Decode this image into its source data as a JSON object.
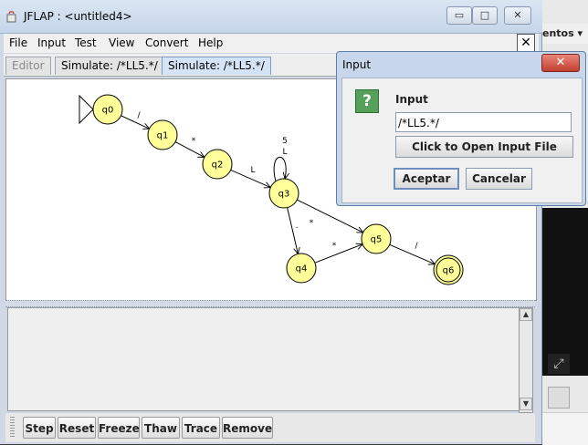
{
  "window": {
    "title": "JFLAP : <untitled4>",
    "min_glyph": "▭",
    "max_glyph": "□",
    "close_glyph": "✕"
  },
  "menu": [
    "File",
    "Input",
    "Test",
    "View",
    "Convert",
    "Help"
  ],
  "inner_close_glyph": "✕",
  "tabs": [
    {
      "label": "Editor",
      "state": "disabled"
    },
    {
      "label": "Simulate: /*LL5.*/",
      "state": "normal"
    },
    {
      "label": "Simulate: /*LL5.*/",
      "state": "active"
    }
  ],
  "automaton": {
    "state_fill": "#ffff99",
    "states": [
      {
        "id": "q0",
        "initial": true,
        "final": false
      },
      {
        "id": "q1",
        "initial": false,
        "final": false
      },
      {
        "id": "q2",
        "initial": false,
        "final": false
      },
      {
        "id": "q3",
        "initial": false,
        "final": false
      },
      {
        "id": "q4",
        "initial": false,
        "final": false
      },
      {
        "id": "q5",
        "initial": false,
        "final": false
      },
      {
        "id": "q6",
        "initial": false,
        "final": true
      }
    ],
    "transitions": [
      {
        "from": "q0",
        "to": "q1",
        "label": "/"
      },
      {
        "from": "q1",
        "to": "q2",
        "label": "*"
      },
      {
        "from": "q2",
        "to": "q3",
        "label": "L"
      },
      {
        "from": "q3",
        "to": "q3",
        "label": "5"
      },
      {
        "from": "q3",
        "to": "q3",
        "label": "L"
      },
      {
        "from": "q3",
        "to": "q5",
        "label": "*"
      },
      {
        "from": "q3",
        "to": "q4",
        "label": "."
      },
      {
        "from": "q4",
        "to": "q5",
        "label": "*"
      },
      {
        "from": "q5",
        "to": "q6",
        "label": "/"
      }
    ]
  },
  "toolbar": [
    "Step",
    "Reset",
    "Freeze",
    "Thaw",
    "Trace",
    "Remove"
  ],
  "dialog": {
    "title": "Input",
    "close_glyph": "✕",
    "icon_glyph": "?",
    "label": "Input",
    "value": "/*LL5.*/",
    "open_file_label": "Click to Open Input File",
    "ok_label": "Aceptar",
    "cancel_label": "Cancelar"
  },
  "background_app": {
    "menu_fragment": "entos ▾"
  }
}
